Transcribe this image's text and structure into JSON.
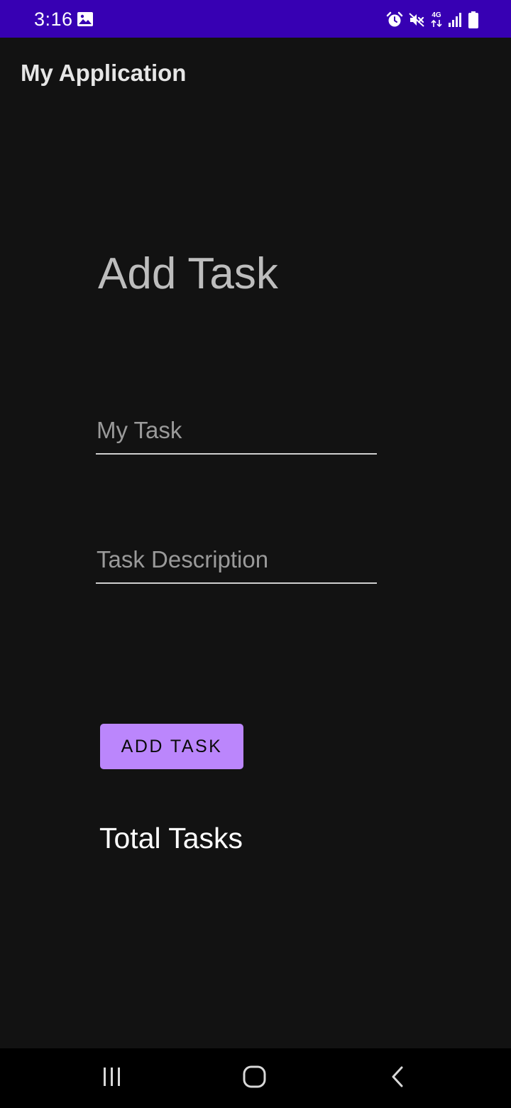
{
  "status_bar": {
    "time": "3:16",
    "network_type": "4G",
    "icons": [
      "gallery-icon",
      "alarm-icon",
      "mute-icon",
      "network-4g-icon",
      "signal-icon",
      "battery-icon"
    ]
  },
  "app_bar": {
    "title": "My Application"
  },
  "main": {
    "heading": "Add Task",
    "task_field": {
      "placeholder": "My Task",
      "value": ""
    },
    "description_field": {
      "placeholder": "Task Description",
      "value": ""
    },
    "add_button_label": "ADD TASK",
    "total_label": "Total Tasks"
  },
  "nav_bar": {
    "icons": [
      "recents-icon",
      "home-icon",
      "back-icon"
    ]
  },
  "colors": {
    "status_bar": "#3700b3",
    "background": "#121212",
    "button": "#bb86fc",
    "nav_bar": "#000000"
  }
}
